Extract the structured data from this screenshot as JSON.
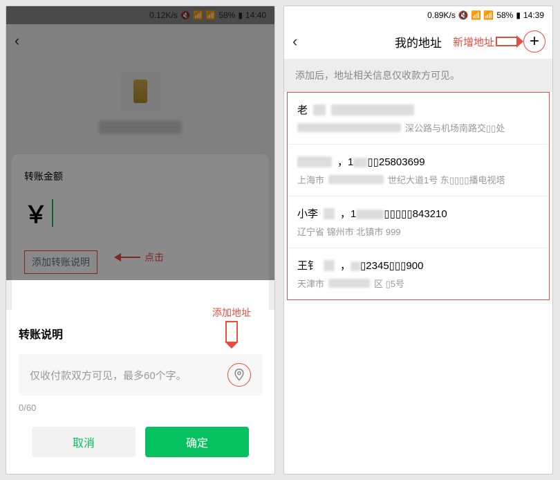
{
  "left": {
    "status": {
      "speed": "0.12K/s",
      "icons": "🔇 📶 📶",
      "battery": "58%",
      "time": "14:40"
    },
    "amount_label": "转账金额",
    "currency_symbol": "￥",
    "add_note_label": "添加转账说明",
    "click_anno": "点击",
    "dialog": {
      "title": "转账说明",
      "add_addr_anno": "添加地址",
      "placeholder": "仅收付款双方可见，最多60个字。",
      "char_count": "0/60",
      "cancel": "取消",
      "ok": "确定"
    }
  },
  "right": {
    "status": {
      "speed": "0.89K/s",
      "icons": "🔇 📶 📶",
      "battery": "58%",
      "time": "14:39"
    },
    "title": "我的地址",
    "new_addr_anno": "新增地址",
    "help_text": "添加后，地址相关信息仅收款方可见。",
    "addresses": [
      {
        "name_prefix": "老",
        "detail_suffix": "深公路与机场南路交▯▯处"
      },
      {
        "phone_partial": "▯▯25803699",
        "detail_prefix": "上海市",
        "detail_mid": "世纪大道1号 东▯▯▯▯播电视塔"
      },
      {
        "name_prefix": "小李",
        "phone_partial": "▯▯▯▯▯843210",
        "detail": "辽宁省 锦州市 北镇市 999"
      },
      {
        "name_prefix": "王钅",
        "phone_partial": "▯2345▯▯▯900",
        "detail_prefix": "天津市",
        "detail_suffix": "区 ▯5号"
      }
    ]
  }
}
